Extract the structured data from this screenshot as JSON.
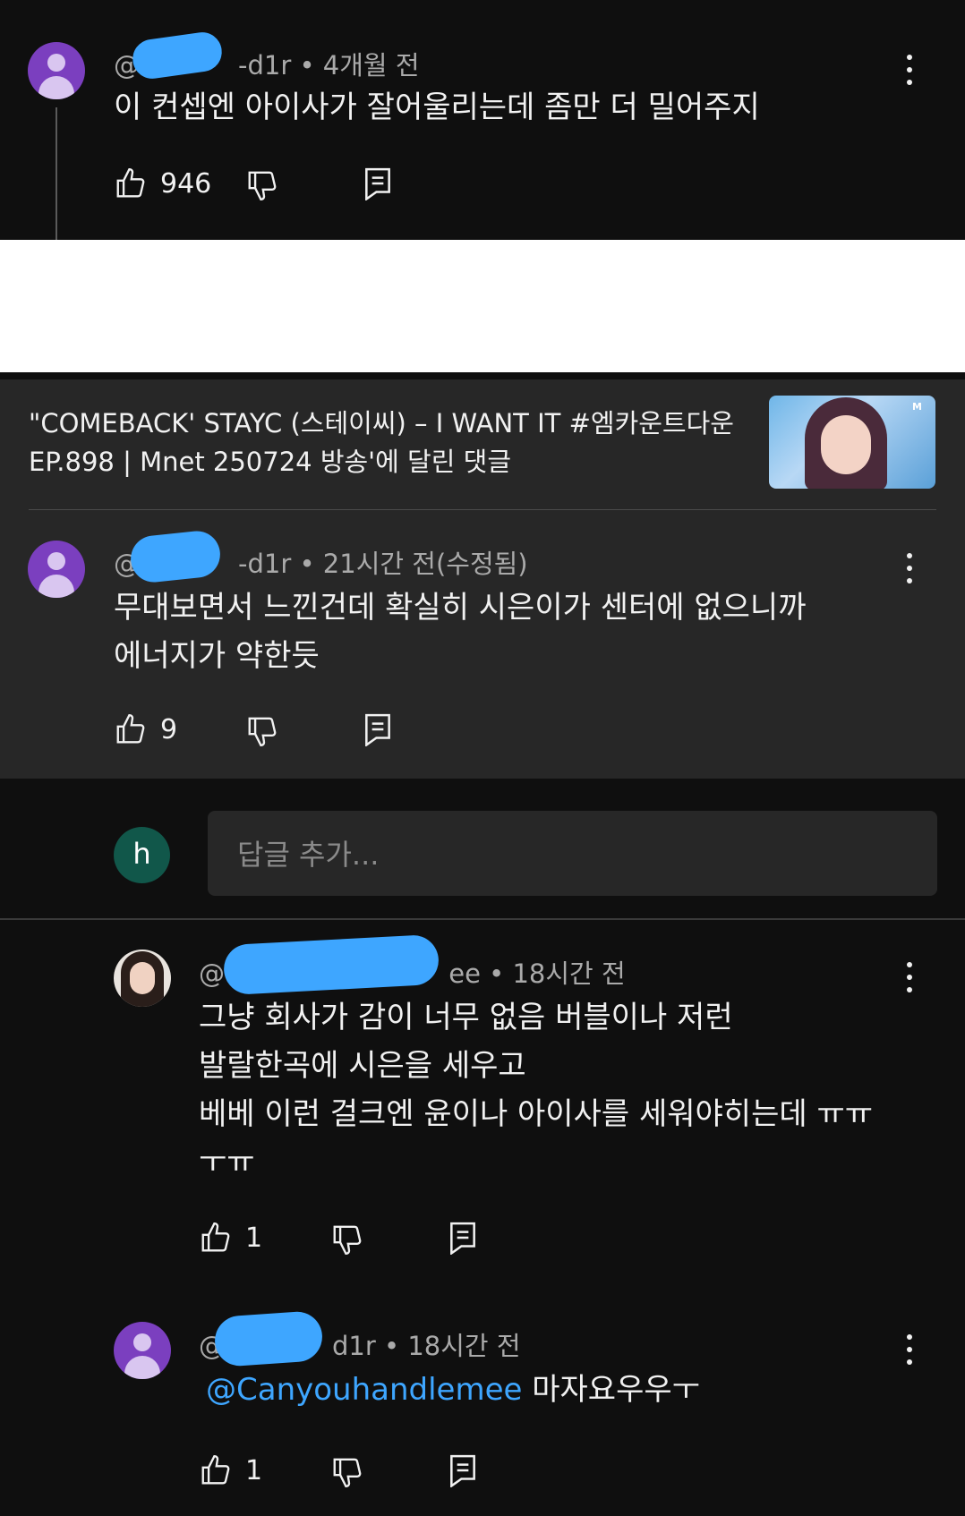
{
  "top_comment": {
    "handle": "@",
    "handle_suffix": "-d1r",
    "time": " • 4개월 전",
    "text": "이 컨셉엔 아이사가 잘어울리는데 좀만 더 밀어주지",
    "likes": "946"
  },
  "video": {
    "title_line1": "\"COMEBACK' STAYC (스테이씨) – I WANT IT #엠카운트다운",
    "title_line2": "EP.898 | Mnet 250724 방송'에 달린 댓글",
    "thumbnail_badge": "M"
  },
  "comment2": {
    "handle": "@",
    "handle_suffix": "-d1r",
    "time": " • 21시간 전(수정됨)",
    "text_line1": "무대보면서 느낀건데 확실히 시은이가 센터에 없으니까",
    "text_line2": "에너지가 약한듯",
    "likes": "9"
  },
  "reply_box": {
    "avatar_letter": "h",
    "placeholder": "답글 추가..."
  },
  "reply1": {
    "handle": "@C",
    "handle_suffix": "ee",
    "time": " • 18시간 전",
    "text_line1": "그냥 회사가 감이 너무 없음 버블이나 저런",
    "text_line2": "발랄한곡에 시은을 세우고",
    "text_line3": "베베 이런 걸크엔 윤이나 아이사를 세워야히는데 ㅠㅠ",
    "text_line4": "ㅜㅠ",
    "likes": "1"
  },
  "reply2": {
    "handle": "@",
    "handle_suffix": "d1r",
    "time": " • 18시간 전",
    "mention": "@Canyouhandlemee",
    "text": " 마자요우우ㅜ",
    "likes": "1"
  },
  "colors": {
    "background": "#0f0f0f",
    "panel": "#272727",
    "mention": "#3ea6ff",
    "avatar": "#7b3fbf"
  },
  "icons": [
    "like-icon",
    "dislike-icon",
    "reply-icon",
    "more-icon"
  ]
}
